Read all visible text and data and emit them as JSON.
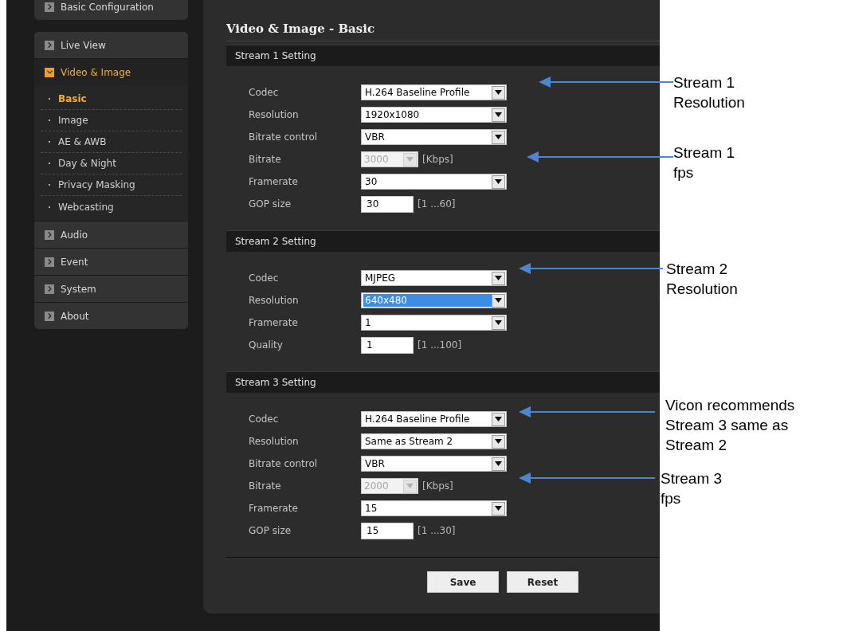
{
  "sidebar": {
    "top_item": {
      "label": "Basic Configuration"
    },
    "menu": [
      {
        "label": "Live View",
        "expanded": false
      },
      {
        "label": "Video & Image",
        "expanded": true,
        "children": [
          {
            "label": "Basic",
            "selected": true
          },
          {
            "label": "Image",
            "selected": false
          },
          {
            "label": "AE & AWB",
            "selected": false
          },
          {
            "label": "Day & Night",
            "selected": false
          },
          {
            "label": "Privacy Masking",
            "selected": false
          },
          {
            "label": "Webcasting",
            "selected": false
          }
        ]
      },
      {
        "label": "Audio",
        "expanded": false
      },
      {
        "label": "Event",
        "expanded": false
      },
      {
        "label": "System",
        "expanded": false
      },
      {
        "label": "About",
        "expanded": false
      }
    ]
  },
  "page_title": "Video & Image - Basic",
  "sections": [
    {
      "title": "Stream 1 Setting",
      "fields": [
        {
          "kind": "select",
          "label": "Codec",
          "value": "H.264 Baseline Profile",
          "highlighted": false
        },
        {
          "kind": "select",
          "label": "Resolution",
          "value": "1920x1080",
          "highlighted": false
        },
        {
          "kind": "select",
          "label": "Bitrate control",
          "value": "VBR",
          "highlighted": false
        },
        {
          "kind": "small_select",
          "label": "Bitrate",
          "value": "3000",
          "disabled": true,
          "unit": "[Kbps]"
        },
        {
          "kind": "select",
          "label": "Framerate",
          "value": "30",
          "highlighted": false
        },
        {
          "kind": "input",
          "label": "GOP size",
          "value": "30",
          "range": "[1 ...60]"
        }
      ]
    },
    {
      "title": "Stream 2 Setting",
      "fields": [
        {
          "kind": "select",
          "label": "Codec",
          "value": "MJPEG",
          "highlighted": false
        },
        {
          "kind": "select",
          "label": "Resolution",
          "value": "640x480",
          "highlighted": true
        },
        {
          "kind": "select",
          "label": "Framerate",
          "value": "1",
          "highlighted": false
        },
        {
          "kind": "input",
          "label": "Quality",
          "value": "1",
          "range": "[1 ...100]"
        }
      ]
    },
    {
      "title": "Stream 3 Setting",
      "fields": [
        {
          "kind": "select",
          "label": "Codec",
          "value": "H.264 Baseline Profile",
          "highlighted": false
        },
        {
          "kind": "select",
          "label": "Resolution",
          "value": "Same as Stream 2",
          "highlighted": false
        },
        {
          "kind": "select",
          "label": "Bitrate control",
          "value": "VBR",
          "highlighted": false
        },
        {
          "kind": "small_select",
          "label": "Bitrate",
          "value": "2000",
          "disabled": true,
          "unit": "[Kbps]"
        },
        {
          "kind": "select",
          "label": "Framerate",
          "value": "15",
          "highlighted": false
        },
        {
          "kind": "input",
          "label": "GOP size",
          "value": "15",
          "range": "[1 ...30]"
        }
      ]
    }
  ],
  "buttons": [
    "Save",
    "Reset"
  ],
  "callouts": [
    {
      "lines": [
        "Stream 1",
        "Resolution"
      ]
    },
    {
      "lines": [
        "Stream 1",
        "fps"
      ]
    },
    {
      "lines": [
        "Stream 2",
        "Resolution"
      ]
    },
    {
      "lines": [
        "Vicon recommends",
        "Stream 3 same as",
        "Stream 2"
      ]
    },
    {
      "lines": [
        "Stream 3",
        "fps"
      ]
    }
  ]
}
